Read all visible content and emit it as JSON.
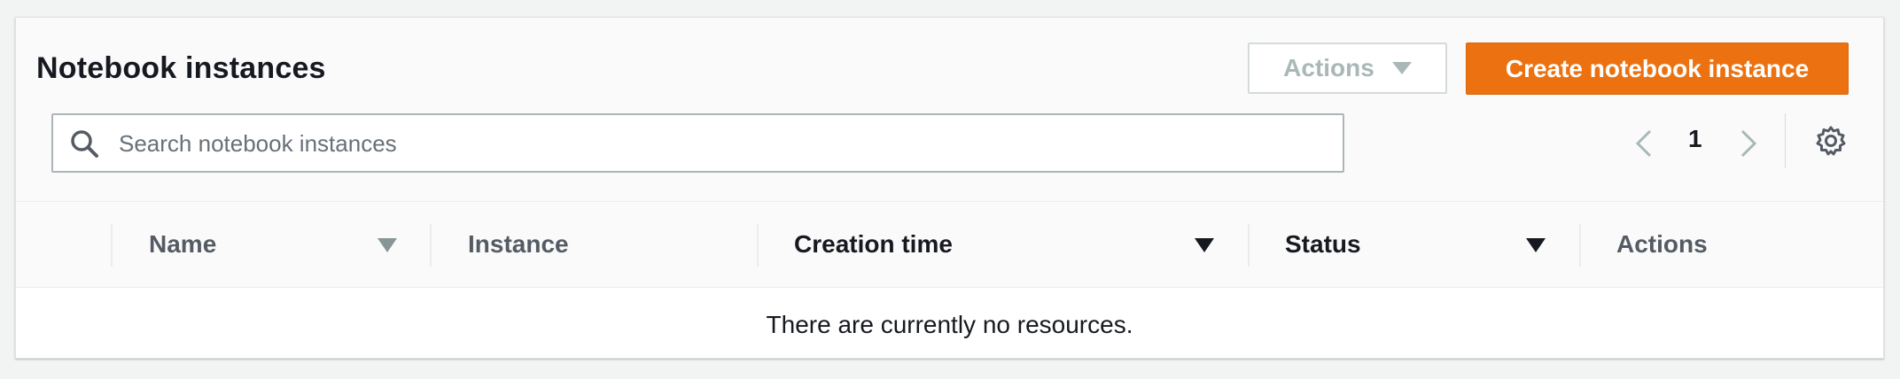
{
  "header": {
    "title": "Notebook instances",
    "actions_label": "Actions",
    "create_label": "Create notebook instance"
  },
  "search": {
    "placeholder": "Search notebook instances",
    "value": ""
  },
  "pagination": {
    "current_page": "1"
  },
  "table": {
    "columns": [
      {
        "label": "Name",
        "sortable": true,
        "sort_state": "muted"
      },
      {
        "label": "Instance",
        "sortable": false
      },
      {
        "label": "Creation time",
        "sortable": true,
        "sort_state": "active"
      },
      {
        "label": "Status",
        "sortable": true,
        "sort_state": "active"
      },
      {
        "label": "Actions",
        "sortable": false
      }
    ],
    "empty_message": "There are currently no resources."
  },
  "icons": {
    "search": "search-icon",
    "prev": "chevron-left-icon",
    "next": "chevron-right-icon",
    "settings": "gear-icon",
    "dropdown": "caret-down-icon"
  },
  "colors": {
    "primary": "#ec7211",
    "text": "#16191f",
    "muted": "#aab7b8"
  }
}
